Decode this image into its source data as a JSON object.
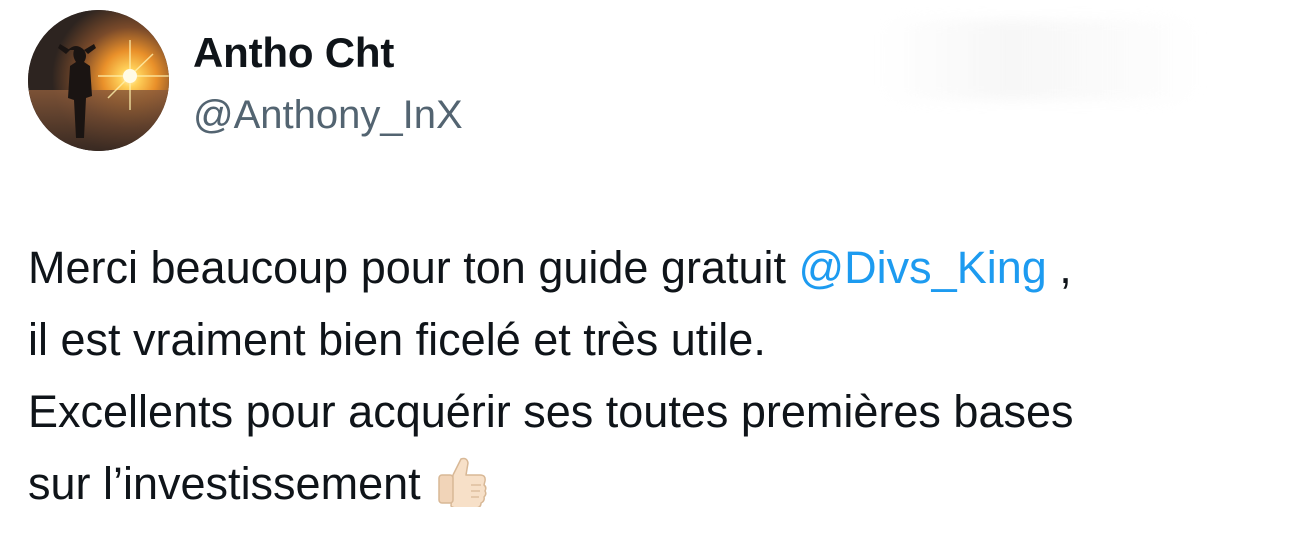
{
  "user": {
    "display_name": "Antho Cht",
    "handle": "@Anthony_InX",
    "avatar_icon": "sunset-silhouette-avatar"
  },
  "tweet": {
    "line1_text": "Merci beaucoup pour ton guide gratuit ",
    "mention": "@Divs_King",
    "line1_tail": " ,",
    "line2": "il est vraiment bien ficelé et très utile.",
    "line3": "Excellents pour acquérir ses toutes premières bases",
    "line4": "sur l’investissement",
    "emoji_icon": "thumbs-up-icon"
  },
  "colors": {
    "text": "#0f1419",
    "handle": "#536471",
    "mention": "#1d9bf0"
  }
}
